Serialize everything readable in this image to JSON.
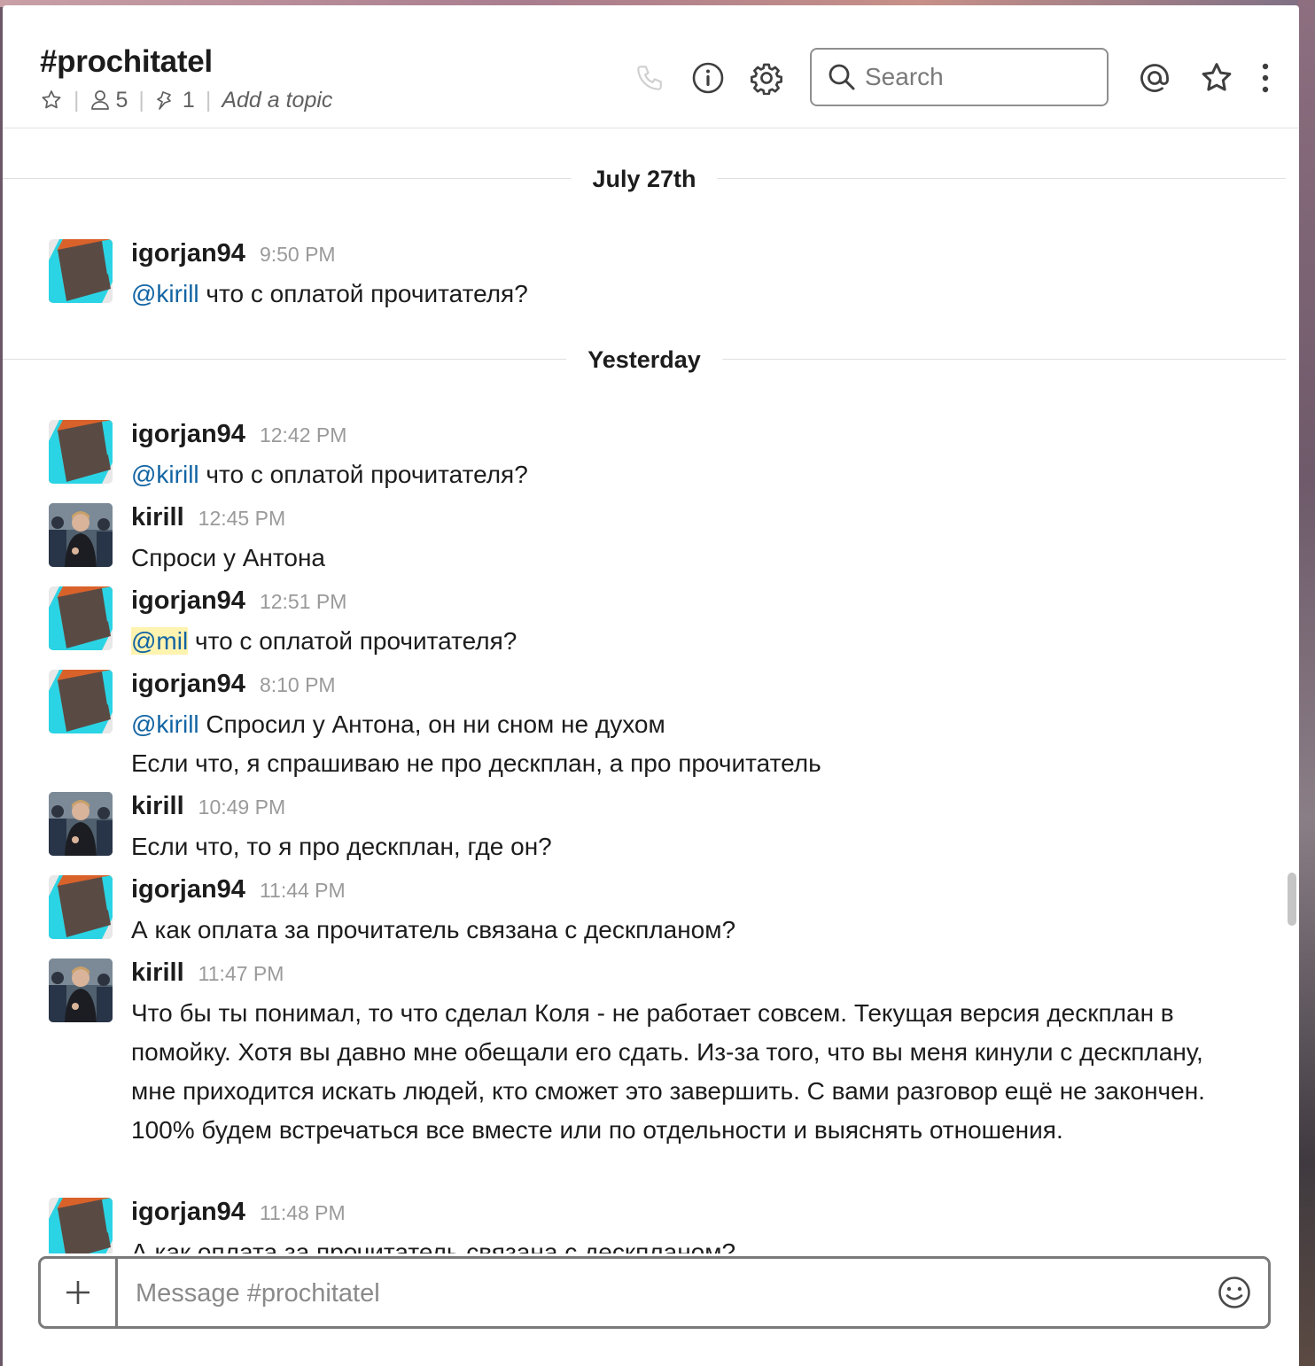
{
  "channel": {
    "title": "#prochitatel",
    "members_count": "5",
    "pinned_count": "1",
    "topic_placeholder": "Add a topic"
  },
  "header": {
    "search_placeholder": "Search"
  },
  "day_dividers": [
    "July 27th",
    "Yesterday"
  ],
  "messages": [
    {
      "author": "igorjan94",
      "time": "9:50 PM",
      "mention": "@kirill",
      "text": " что с оплатой прочитателя?",
      "avatar": "geometric"
    },
    {
      "author": "igorjan94",
      "time": "12:42 PM",
      "mention": "@kirill",
      "text": " что с оплатой прочитателя?",
      "avatar": "geometric"
    },
    {
      "author": "kirill",
      "time": "12:45 PM",
      "mention": "",
      "text": "Спроси у Антона",
      "avatar": "photo"
    },
    {
      "author": "igorjan94",
      "time": "12:51 PM",
      "mention": "@mil",
      "text": " что с оплатой прочитателя?",
      "avatar": "geometric"
    },
    {
      "author": "igorjan94",
      "time": "8:10 PM",
      "mention": "@kirill",
      "text": " Спросил у Антона, он ни сном не духом",
      "text2": "Если что, я спрашиваю не про дескплан, а про прочитатель",
      "avatar": "geometric"
    },
    {
      "author": "kirill",
      "time": "10:49 PM",
      "mention": "",
      "text": "Если что, то я про дескплан, где он?",
      "avatar": "photo"
    },
    {
      "author": "igorjan94",
      "time": "11:44 PM",
      "mention": "",
      "text": "А как оплата за прочитатель связана с дескпланом?",
      "avatar": "geometric"
    },
    {
      "author": "kirill",
      "time": "11:47 PM",
      "mention": "",
      "text": "Что бы ты понимал, то что сделал Коля - не работает совсем. Текущая версия дескплан в помойку. Хотя вы давно мне обещали его сдать. Из-за того, что вы меня кинули с дескплану, мне приходится искать людей, кто сможет это завершить. С вами разговор ещё не закончен. 100% будем встречаться все вместе или по отдельности и выяснять отношения.",
      "avatar": "photo"
    },
    {
      "author": "igorjan94",
      "time": "11:48 PM",
      "mention": "",
      "text": "А как оплата за прочитатель связана с дескпланом?",
      "avatar": "geometric"
    }
  ],
  "composer": {
    "placeholder": "Message #prochitatel"
  },
  "icons": {
    "call": "phone-icon",
    "info": "info-icon",
    "settings": "gear-icon",
    "search": "search-icon",
    "mentions": "at-icon",
    "starred": "star-icon",
    "more": "more-vertical-icon",
    "add": "plus-icon",
    "emoji": "emoji-icon"
  },
  "colors": {
    "mention": "#1264a3",
    "mention_highlight": "#fff3b0",
    "avatar_orange": "#d9622b",
    "avatar_cyan": "#2ad4e4",
    "avatar_dark": "#5a4a44"
  }
}
